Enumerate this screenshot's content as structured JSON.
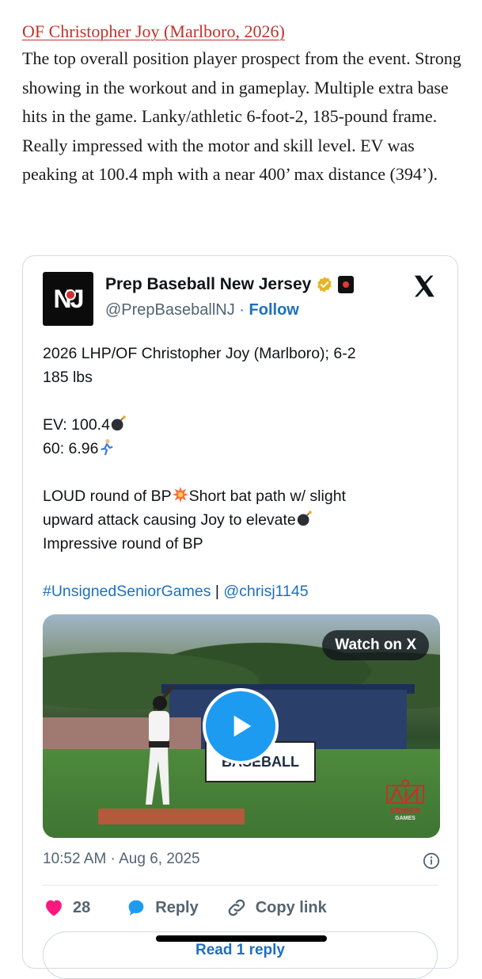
{
  "article": {
    "heading": "OF Christopher Joy (Marlboro, 2026)",
    "body": "The top overall position player prospect from the event. Strong showing in the workout and in gameplay. Multiple extra base hits in the game. Lanky/athletic 6-foot-2, 185-pound frame. Really impressed with the motor and skill level. EV was peaking at 100.4 mph with a near 400’ max distance (394’)."
  },
  "tweet": {
    "author_name": "Prep Baseball New Jersey",
    "handle": "@PrepBaseballNJ",
    "separator": "·",
    "follow_label": "Follow",
    "avatar_text": "NJ",
    "line1": "2026 LHP/OF Christopher Joy (Marlboro); 6-2",
    "line2": "185 lbs",
    "ev": "EV: 100.4",
    "sixty": "60: 6.96",
    "bp_line1a": "LOUD round of BP",
    "bp_line1b": "Short bat path w/ slight",
    "bp_line2": "upward attack causing Joy to elevate",
    "bp_line3": "Impressive round of BP",
    "hashtag": "#UnsignedSeniorGames",
    "pipe": " | ",
    "mention": "@chrisj1145",
    "watch_label": "Watch on X",
    "sign_text": "BASEBALL",
    "logo_text": "SENIOR",
    "logo_sub": "GAMES",
    "timestamp": "10:52 AM · Aug 6, 2025",
    "likes": "28",
    "reply_label": "Reply",
    "copy_label": "Copy link",
    "read_reply_label": "Read 1 reply"
  },
  "colors": {
    "heading": "#c0332b",
    "link": "#1d6fbf",
    "like": "#f91880",
    "reply_icon": "#1d9bf0",
    "muted": "#536471"
  },
  "icons": [
    "verified-badge-icon",
    "org-badge-icon",
    "x-logo-icon",
    "bomb-icon",
    "runner-icon",
    "explosion-icon",
    "play-icon",
    "info-icon",
    "heart-icon",
    "reply-icon",
    "link-icon"
  ]
}
